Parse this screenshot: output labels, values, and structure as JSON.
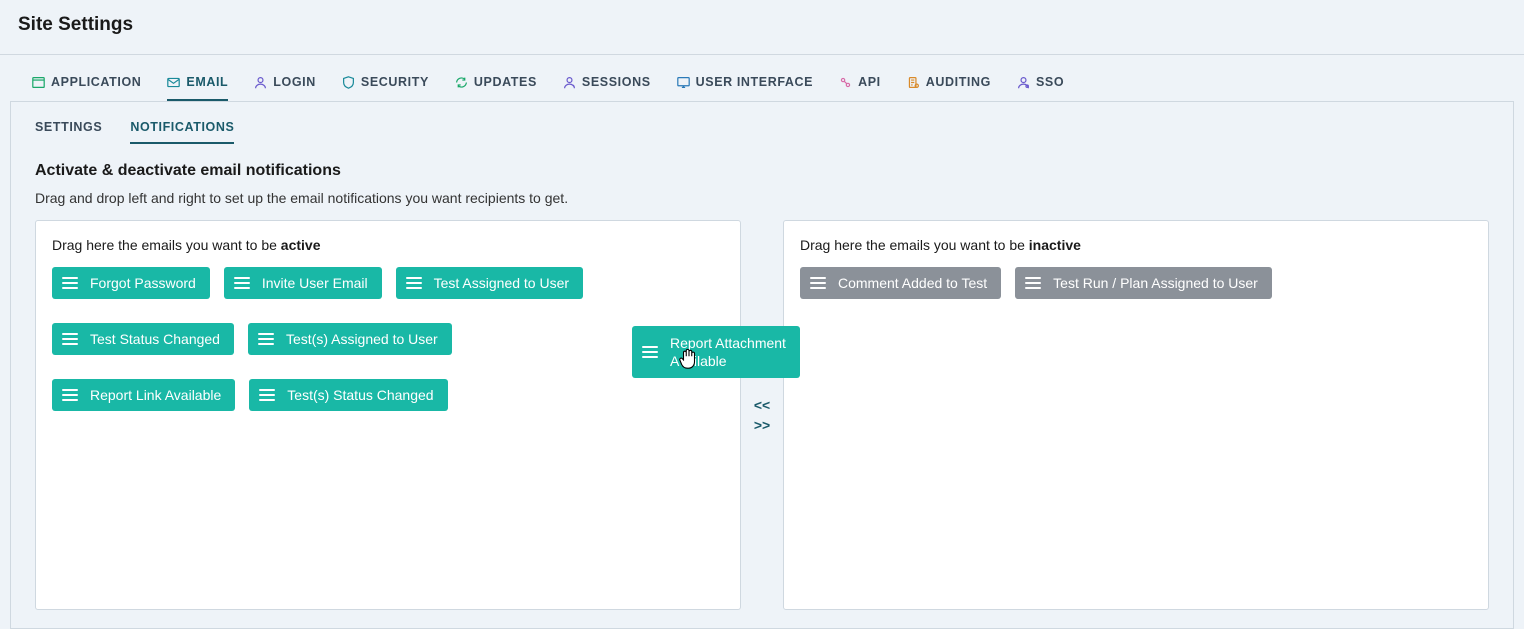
{
  "page_title": "Site Settings",
  "tabs_primary": [
    {
      "id": "application",
      "label": "APPLICATION",
      "icon": "application-icon",
      "color": "ic-green"
    },
    {
      "id": "email",
      "label": "EMAIL",
      "icon": "email-icon",
      "color": "ic-teal",
      "active": true
    },
    {
      "id": "login",
      "label": "LOGIN",
      "icon": "login-icon",
      "color": "ic-purple"
    },
    {
      "id": "security",
      "label": "SECURITY",
      "icon": "security-icon",
      "color": "ic-teal"
    },
    {
      "id": "updates",
      "label": "UPDATES",
      "icon": "updates-icon",
      "color": "ic-green"
    },
    {
      "id": "sessions",
      "label": "SESSIONS",
      "icon": "sessions-icon",
      "color": "ic-purple"
    },
    {
      "id": "user-interface",
      "label": "USER INTERFACE",
      "icon": "user-interface-icon",
      "color": "ic-blue"
    },
    {
      "id": "api",
      "label": "API",
      "icon": "api-icon",
      "color": "ic-pink"
    },
    {
      "id": "auditing",
      "label": "AUDITING",
      "icon": "auditing-icon",
      "color": "ic-orange"
    },
    {
      "id": "sso",
      "label": "SSO",
      "icon": "sso-icon",
      "color": "ic-purple"
    }
  ],
  "tabs_secondary": [
    {
      "id": "settings",
      "label": "SETTINGS"
    },
    {
      "id": "notifications",
      "label": "NOTIFICATIONS",
      "active": true
    }
  ],
  "section": {
    "title": "Activate & deactivate email notifications",
    "description": "Drag and drop left and right to set up the email notifications you want recipients to get."
  },
  "active_zone": {
    "prefix": "Drag here the emails you want to be ",
    "strong": "active",
    "items": [
      "Forgot Password",
      "Invite User Email",
      "Test Assigned to User",
      "Test Status Changed",
      "Test(s) Assigned to User",
      "Report Link Available",
      "Test(s) Status Changed"
    ]
  },
  "inactive_zone": {
    "prefix": "Drag here the emails you want to be ",
    "strong": "inactive",
    "items": [
      "Comment Added to Test",
      "Test Run / Plan Assigned to User"
    ]
  },
  "dragging": {
    "line1": "Report Attachment",
    "line2": "Available"
  },
  "move_buttons": {
    "left": "<<",
    "right": ">>"
  }
}
